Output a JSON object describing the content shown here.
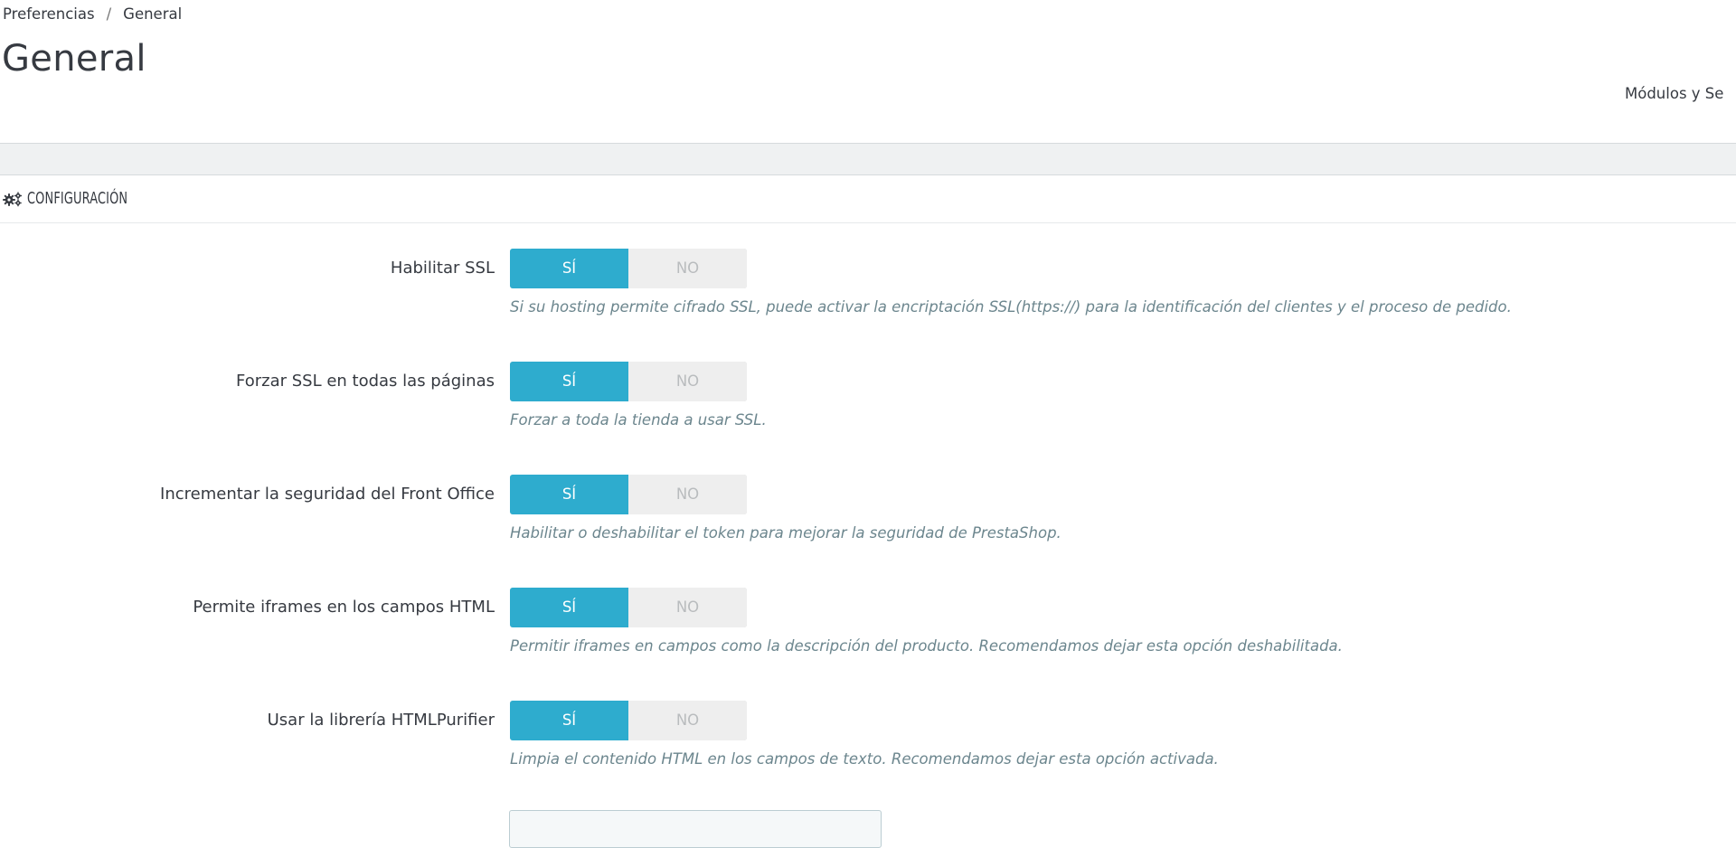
{
  "breadcrumb": {
    "parent": "Preferencias",
    "separator": "/",
    "current": "General"
  },
  "page_title": "General",
  "top_tab": "Módulos y Se",
  "panel": {
    "title": "CONFIGURACIÓN",
    "icon": "cogs-icon"
  },
  "switch_labels": {
    "yes": "SÍ",
    "no": "NO"
  },
  "settings": [
    {
      "label": "Habilitar SSL",
      "value": "SÍ",
      "help": "Si su hosting permite cifrado SSL, puede activar la encriptación SSL(https://) para la identificación del clientes y el proceso de pedido."
    },
    {
      "label": "Forzar SSL en todas las páginas",
      "value": "SÍ",
      "help": "Forzar a toda la tienda a usar SSL."
    },
    {
      "label": "Incrementar la seguridad del Front Office",
      "value": "SÍ",
      "help": "Habilitar o deshabilitar el token para mejorar la seguridad de PrestaShop."
    },
    {
      "label": "Permite iframes en los campos HTML",
      "value": "SÍ",
      "help": "Permitir iframes en campos como la descripción del producto. Recomendamos dejar esta opción deshabilitada."
    },
    {
      "label": "Usar la librería HTMLPurifier",
      "value": "SÍ",
      "help": "Limpia el contenido HTML en los campos de texto. Recomendamos dejar esta opción activada."
    }
  ],
  "colors": {
    "switch_active": "#2eacce",
    "switch_inactive": "#eeeeee",
    "help_text": "#6c868e",
    "toolbar_band": "#eff1f2"
  }
}
